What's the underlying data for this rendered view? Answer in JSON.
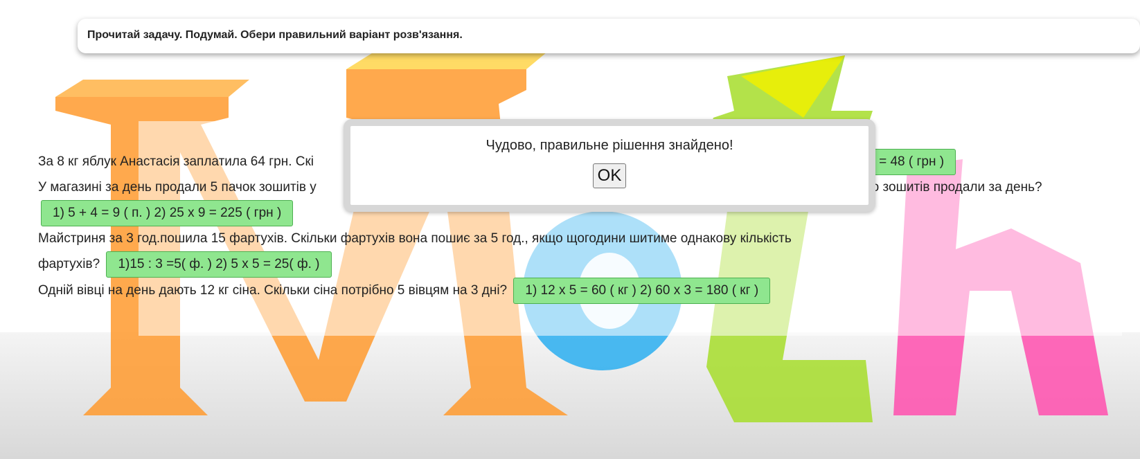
{
  "instruction": "Прочитай задачу. Подумай. Обери правильний варіант розв'язання.",
  "tasks": [
    {
      "question": "За 8 кг яблук Анастасія заплатила 64 грн. Скі",
      "answer": "8 х 6 = 48 ( грн )"
    },
    {
      "question": "У магазині за день продали 5 пачок зошитів у",
      "question_tail": "всього зошитів продали за день?",
      "answer": "1) 5 + 4 = 9 ( п. ) 2) 25 х 9 = 225 ( грн )"
    },
    {
      "question": "Майстриня за 3 год.пошила 15 фартухів. Скільки фартухів вона пошиє за 5 год., якщо щогодини шитиме однакову кількість фартухів?",
      "answer": "1)15 : 3 =5( ф. ) 2) 5 х 5 = 25( ф. )"
    },
    {
      "question": "Одній вівці на день дають 12 кг сіна. Скільки сіна потрібно 5 вівцям на 3 дні?",
      "answer": "1) 12 х 5 = 60 ( кг ) 2) 60 х 3 = 180 ( кг )"
    }
  ],
  "dialog": {
    "message": "Чудово, правильне рішення знайдено!",
    "ok_label": "OK"
  },
  "background_image": {
    "word": "Math",
    "colors": [
      "#ff8c1a",
      "#ffc400",
      "#e8f000",
      "#1ea7f0",
      "#9ad93a",
      "#ff5ab4"
    ]
  }
}
